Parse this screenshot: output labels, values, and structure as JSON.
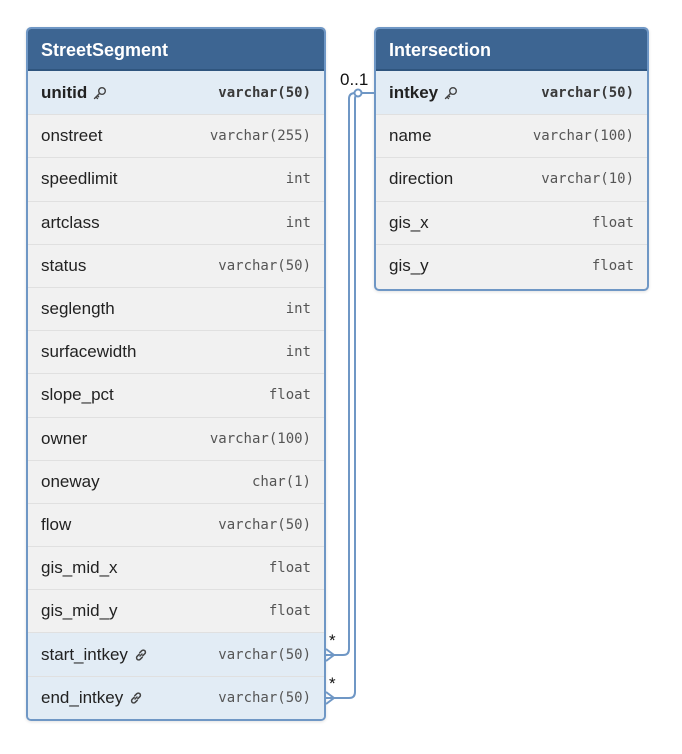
{
  "tables": [
    {
      "id": "street",
      "name": "StreetSegment",
      "columns": [
        {
          "name": "unitid",
          "type": "varchar(50)",
          "pk": true,
          "icon": "key-icon"
        },
        {
          "name": "onstreet",
          "type": "varchar(255)"
        },
        {
          "name": "speedlimit",
          "type": "int"
        },
        {
          "name": "artclass",
          "type": "int"
        },
        {
          "name": "status",
          "type": "varchar(50)"
        },
        {
          "name": "seglength",
          "type": "int"
        },
        {
          "name": "surfacewidth",
          "type": "int"
        },
        {
          "name": "slope_pct",
          "type": "float"
        },
        {
          "name": "owner",
          "type": "varchar(100)"
        },
        {
          "name": "oneway",
          "type": "char(1)"
        },
        {
          "name": "flow",
          "type": "varchar(50)"
        },
        {
          "name": "gis_mid_x",
          "type": "float"
        },
        {
          "name": "gis_mid_y",
          "type": "float"
        },
        {
          "name": "start_intkey",
          "type": "varchar(50)",
          "fk": true,
          "icon": "link-icon"
        },
        {
          "name": "end_intkey",
          "type": "varchar(50)",
          "fk": true,
          "icon": "link-icon"
        }
      ]
    },
    {
      "id": "inter",
      "name": "Intersection",
      "columns": [
        {
          "name": "intkey",
          "type": "varchar(50)",
          "pk": true,
          "icon": "key-icon"
        },
        {
          "name": "name",
          "type": "varchar(100)"
        },
        {
          "name": "direction",
          "type": "varchar(10)"
        },
        {
          "name": "gis_x",
          "type": "float"
        },
        {
          "name": "gis_y",
          "type": "float"
        }
      ]
    }
  ],
  "relationships": [
    {
      "from": "StreetSegment.start_intkey",
      "to": "Intersection.intkey",
      "from_cardinality": "*",
      "to_cardinality": "0..1"
    },
    {
      "from": "StreetSegment.end_intkey",
      "to": "Intersection.intkey",
      "from_cardinality": "*",
      "to_cardinality": "0..1"
    }
  ],
  "colors": {
    "header": "#3d6592",
    "border": "#6f97c5",
    "connector": "#6f97c5",
    "highlight_row": "#e2ecf5"
  }
}
